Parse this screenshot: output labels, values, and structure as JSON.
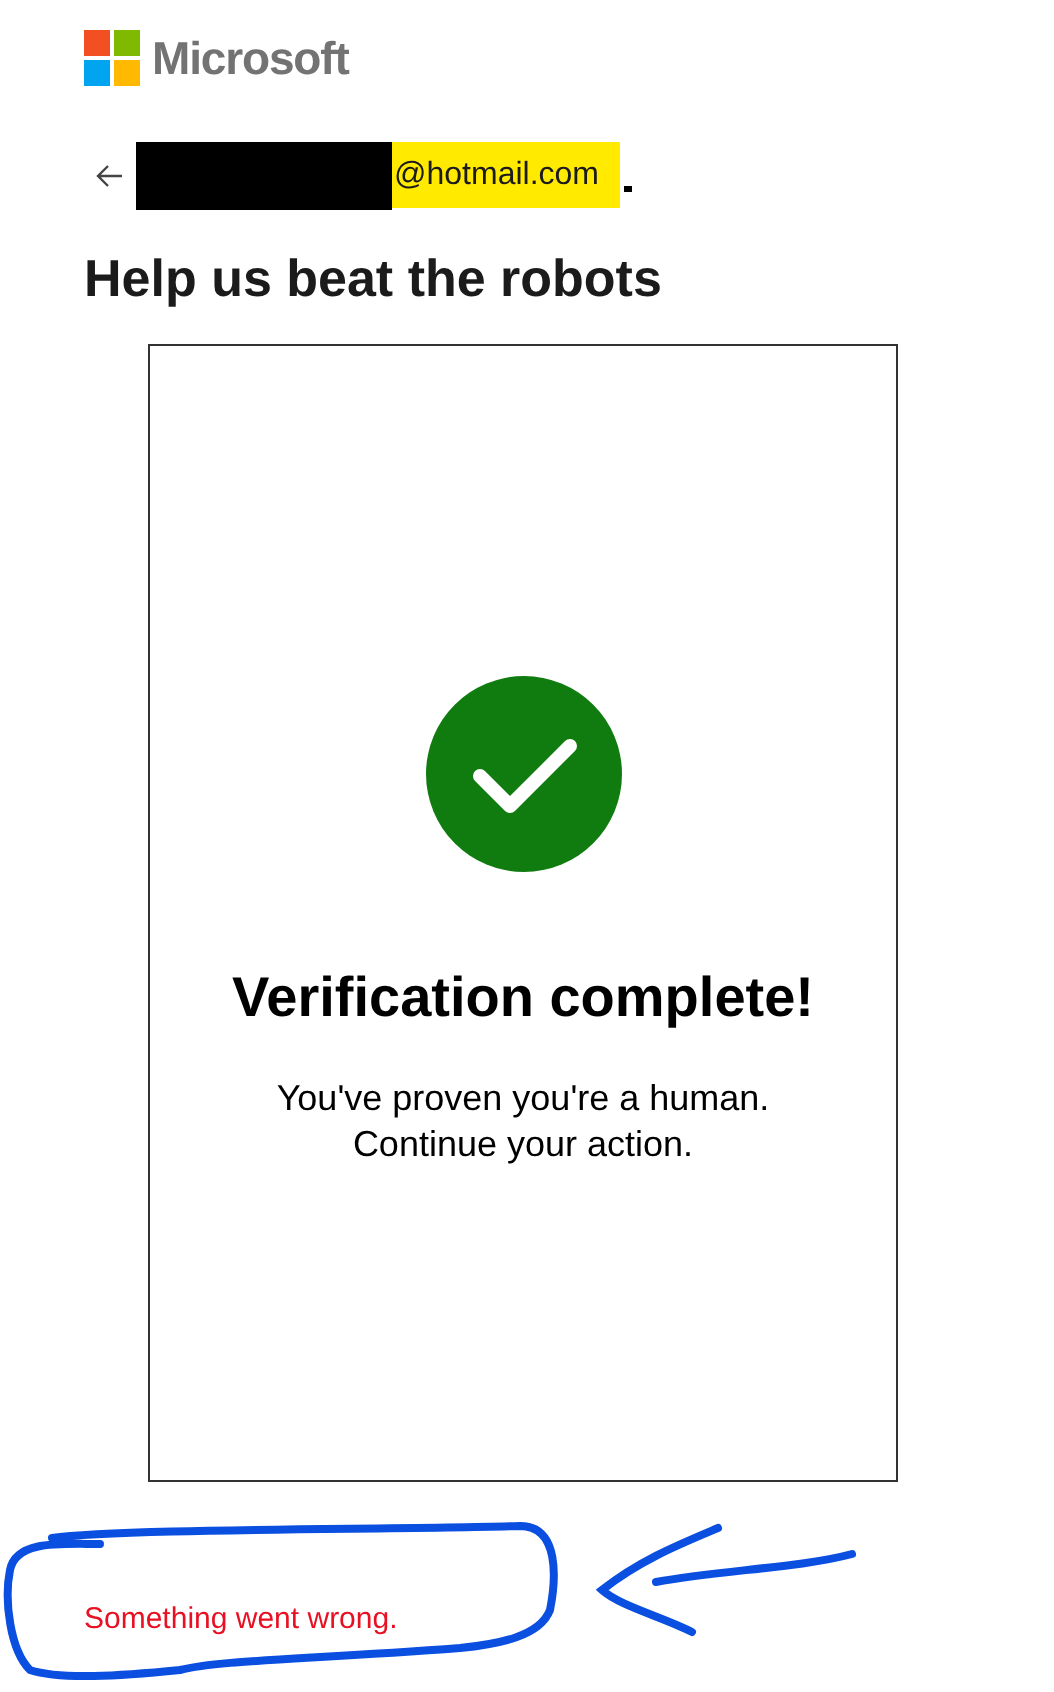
{
  "brand": {
    "name": "Microsoft"
  },
  "account": {
    "email_suffix": "@hotmail.com",
    "redacted": true,
    "highlighted": true
  },
  "title": "Help us beat the robots",
  "verification": {
    "heading": "Verification complete!",
    "lines": [
      "You've proven you're a human.",
      "Continue your action."
    ]
  },
  "error": "Something went wrong.",
  "annotation": {
    "circled": true
  }
}
